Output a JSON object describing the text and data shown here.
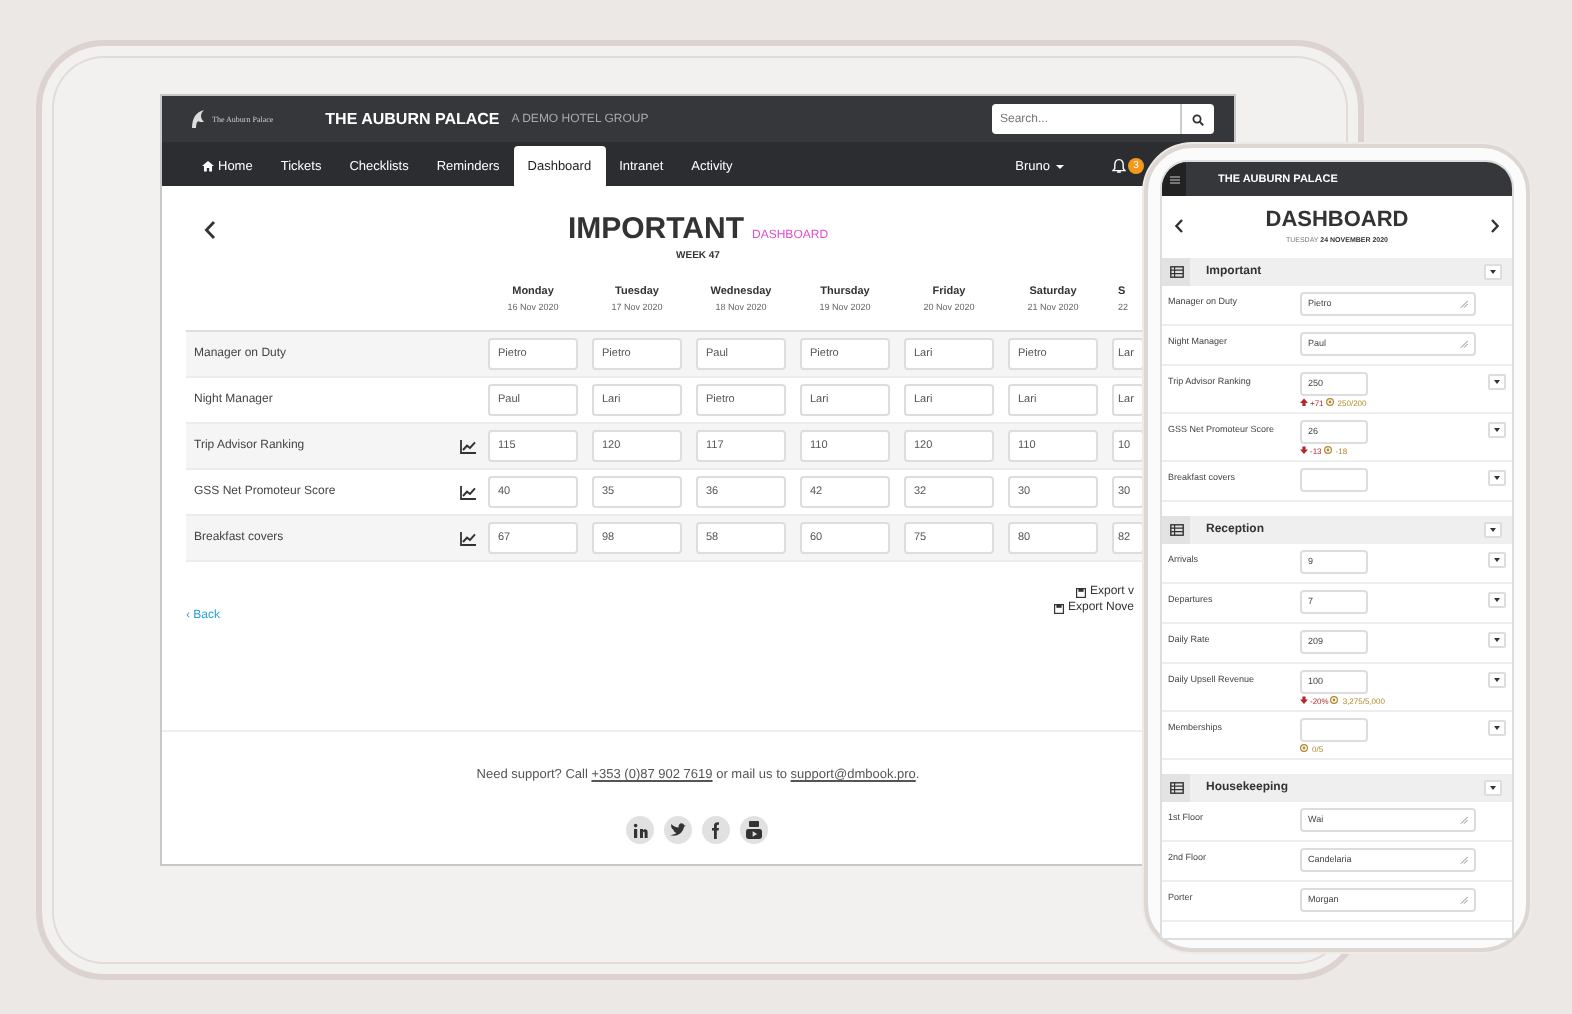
{
  "desktop": {
    "brand": {
      "logo_text": "The Auburn Palace",
      "name": "THE AUBURN PALACE",
      "tagline": "A DEMO HOTEL GROUP"
    },
    "search": {
      "placeholder": "Search..."
    },
    "tabs": [
      {
        "label": "Home",
        "selected": false
      },
      {
        "label": "Tickets",
        "selected": false
      },
      {
        "label": "Checklists",
        "selected": false
      },
      {
        "label": "Reminders",
        "selected": false
      },
      {
        "label": "Dashboard",
        "selected": true
      },
      {
        "label": "Intranet",
        "selected": false
      },
      {
        "label": "Activity",
        "selected": false
      }
    ],
    "user": "Bruno",
    "notifications": "3",
    "page": {
      "title": "IMPORTANT",
      "subtitle": "DASHBOARD",
      "week": "WEEK 47"
    },
    "days": [
      {
        "day": "Monday",
        "date": "16 Nov 2020"
      },
      {
        "day": "Tuesday",
        "date": "17 Nov 2020"
      },
      {
        "day": "Wednesday",
        "date": "18 Nov 2020"
      },
      {
        "day": "Thursday",
        "date": "19 Nov 2020"
      },
      {
        "day": "Friday",
        "date": "20 Nov 2020"
      },
      {
        "day": "Saturday",
        "date": "21 Nov 2020"
      },
      {
        "day": "S",
        "date": "22"
      }
    ],
    "rows": [
      {
        "label": "Manager on Duty",
        "chart": false,
        "values": [
          "Pietro",
          "Pietro",
          "Paul",
          "Pietro",
          "Lari",
          "Pietro",
          "Lar"
        ]
      },
      {
        "label": "Night Manager",
        "chart": false,
        "values": [
          "Paul",
          "Lari",
          "Pietro",
          "Lari",
          "Lari",
          "Lari",
          "Lar"
        ]
      },
      {
        "label": "Trip Advisor Ranking",
        "chart": true,
        "values": [
          "115",
          "120",
          "117",
          "110",
          "120",
          "110",
          "10"
        ]
      },
      {
        "label": "GSS Net Promoteur Score",
        "chart": true,
        "values": [
          "40",
          "35",
          "36",
          "42",
          "32",
          "30",
          "30"
        ]
      },
      {
        "label": "Breakfast covers",
        "chart": true,
        "values": [
          "67",
          "98",
          "58",
          "60",
          "75",
          "80",
          "82"
        ]
      }
    ],
    "exports": [
      "Export v",
      "Export Nove"
    ],
    "back": "‹ Back",
    "footer": {
      "before": "Need support? Call",
      "phone": "+353 (0)87 902 7619",
      "middle": "or mail us to",
      "email": "support@dmbook.pro",
      "after": "."
    }
  },
  "phone": {
    "title": "THE AUBURN PALACE",
    "heading": "DASHBOARD",
    "date": "TUESDAY **24 NOVEMBER 2020**",
    "sections": [
      {
        "title": "Important",
        "rows": [
          {
            "kind": "textarea",
            "label": "Manager on Duty",
            "value": "Pietro"
          },
          {
            "kind": "textarea",
            "label": "Night Manager",
            "value": "Paul"
          },
          {
            "kind": "input",
            "label": "Trip Advisor Ranking",
            "value": "250",
            "change": "+71",
            "rising": true,
            "target": "250/200"
          },
          {
            "kind": "input",
            "label": "GSS Net Promoteur Score",
            "value": "26",
            "change": "-13",
            "rising": false,
            "target": "-18"
          },
          {
            "kind": "input",
            "label": "Breakfast covers"
          }
        ]
      },
      {
        "title": "Reception",
        "rows": [
          {
            "kind": "input",
            "label": "Arrivals",
            "value": "9"
          },
          {
            "kind": "input",
            "label": "Departures",
            "value": "7"
          },
          {
            "kind": "input",
            "label": "Daily Rate",
            "value": "209"
          },
          {
            "kind": "input",
            "label": "Daily Upsell Revenue",
            "value": "100",
            "change": "-20%",
            "rising": false,
            "target": "3,275/5,000"
          },
          {
            "kind": "input",
            "label": "Memberships",
            "target": "0/5"
          }
        ]
      },
      {
        "title": "Housekeeping",
        "rows": [
          {
            "kind": "textarea",
            "label": "1st Floor",
            "value": "Wai"
          },
          {
            "kind": "textarea",
            "label": "2nd Floor",
            "value": "Candelaria"
          },
          {
            "kind": "textarea",
            "label": "Porter",
            "value": "Morgan"
          }
        ]
      }
    ]
  }
}
